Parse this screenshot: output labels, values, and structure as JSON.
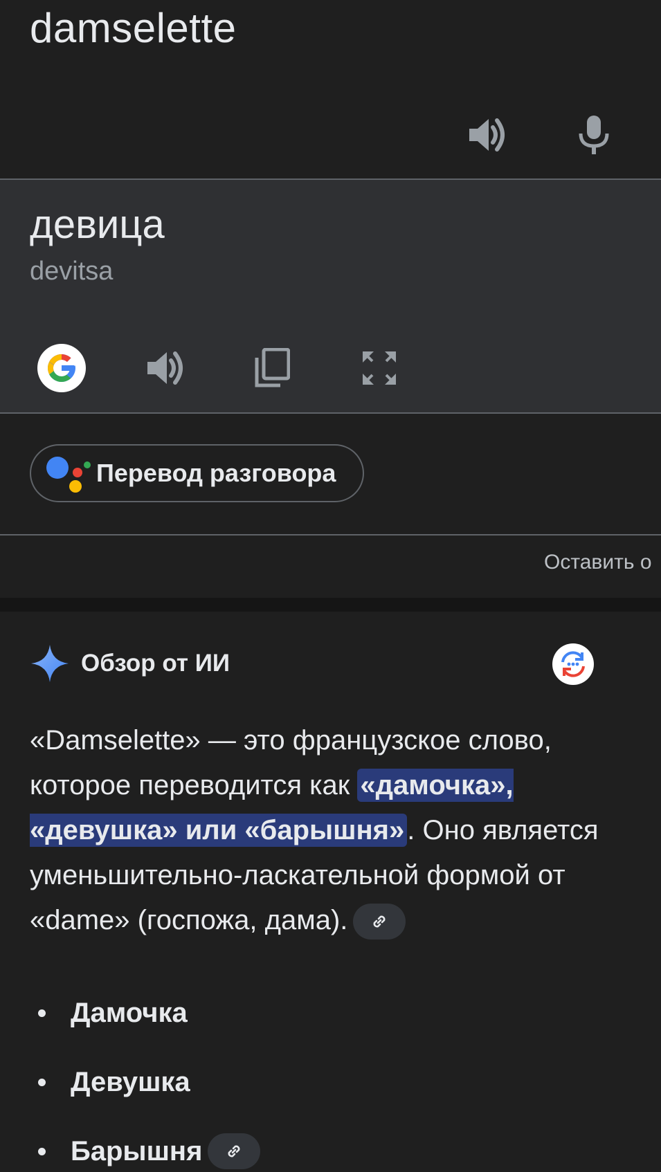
{
  "source": {
    "text": "damselette",
    "icons": {
      "speaker": "speaker-icon",
      "mic": "mic-icon"
    }
  },
  "translation": {
    "text": "девица",
    "transliteration": "devitsa",
    "icons": {
      "google": "google-logo-icon",
      "speaker": "speaker-icon",
      "copy": "copy-icon",
      "fullscreen": "fullscreen-icon"
    }
  },
  "conversation": {
    "label": "Перевод разговора"
  },
  "feedback": {
    "label": "Оставить о"
  },
  "ai_overview": {
    "title": "Обзор от ИИ",
    "paragraph": {
      "part1": "«Damselette» — это французское слово, которое переводится как ",
      "highlight": "«дамочка», «девушка» или «барышня»",
      "part2": ". Оно является уменьшительно-ласкательной формой от «dame» (госпожа, дама)."
    },
    "list": [
      "Дамочка",
      "Девушка",
      "Барышня"
    ],
    "icons": {
      "sparkle": "sparkle-icon",
      "regenerate": "regenerate-icon",
      "link": "link-icon"
    }
  },
  "colors": {
    "background": "#1f1f1f",
    "target_panel": "#2f3033",
    "highlight": "#2a3b7a",
    "google_blue": "#4285f4",
    "google_red": "#ea4335",
    "google_yellow": "#fbbc04",
    "google_green": "#34a853"
  }
}
